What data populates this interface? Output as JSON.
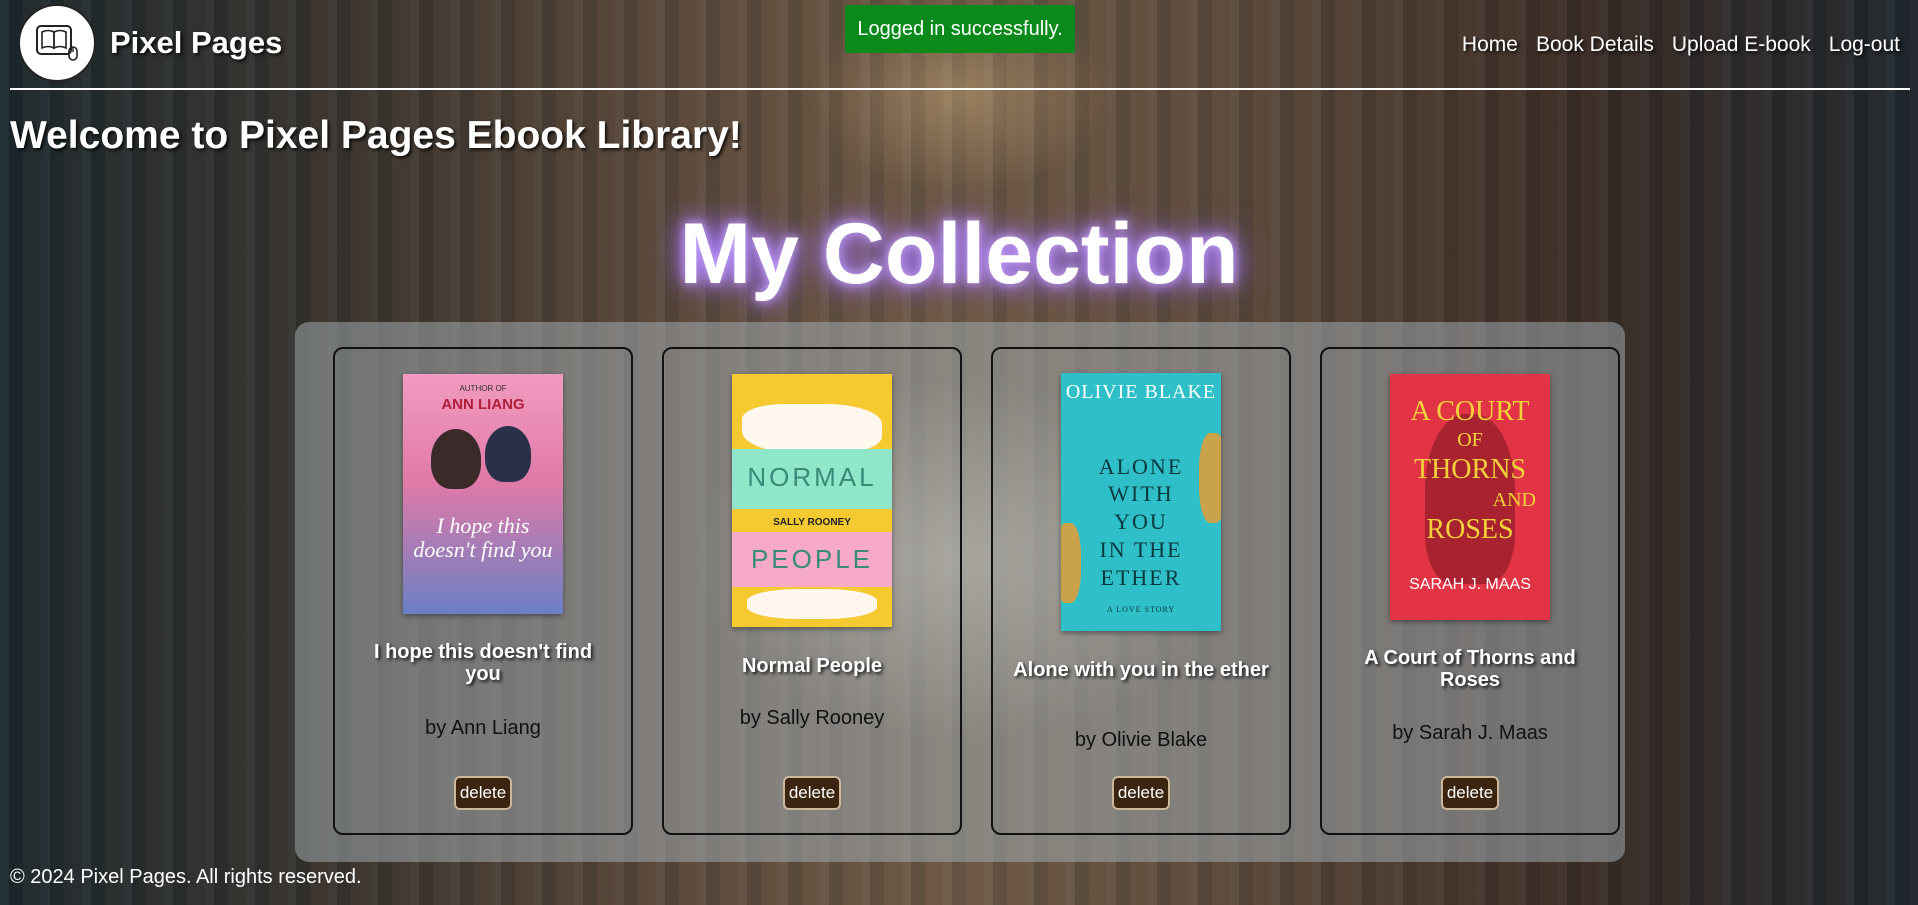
{
  "header": {
    "brand": "Pixel Pages",
    "logo_icon": "book-logo-icon",
    "nav": [
      {
        "label": "Home"
      },
      {
        "label": "Book Details"
      },
      {
        "label": "Upload E-book"
      },
      {
        "label": "Log-out"
      }
    ]
  },
  "toast": {
    "message": "Logged in successfully.",
    "color": "#0a8a1a"
  },
  "welcome": "Welcome to Pixel Pages Ebook Library!",
  "collection_title": "My Collection",
  "books": [
    {
      "title": "I hope this doesn't find you",
      "author": "by Ann Liang",
      "delete_label": "delete",
      "cover": {
        "top_line": "AUTHOR OF",
        "author": "ANN LIANG",
        "title_script": "I hope this doesn't find you",
        "bg": "#e88ab0"
      }
    },
    {
      "title": "Normal People",
      "author": "by Sally Rooney",
      "delete_label": "delete",
      "cover": {
        "word1": "NORMAL",
        "author": "SALLY ROONEY",
        "word2": "PEOPLE",
        "bg": "#f5c930"
      }
    },
    {
      "title": "Alone with you in the ether",
      "author": "by Olivie Blake",
      "delete_label": "delete",
      "cover": {
        "author": "OLIVIE BLAKE",
        "title_lines": [
          "ALONE",
          "WITH",
          "YOU",
          "IN THE",
          "ETHER"
        ],
        "tagline": "A LOVE STORY",
        "bg": "#2fbfc8"
      }
    },
    {
      "title": "A Court of Thorns and Roses",
      "author": "by Sarah J. Maas",
      "delete_label": "delete",
      "cover": {
        "title_lines": [
          "A COURT",
          "OF",
          "THORNS",
          "AND",
          "ROSES"
        ],
        "author": "SARAH J. MAAS",
        "bg": "#e23445"
      }
    }
  ],
  "footer": "© 2024 Pixel Pages. All rights reserved."
}
